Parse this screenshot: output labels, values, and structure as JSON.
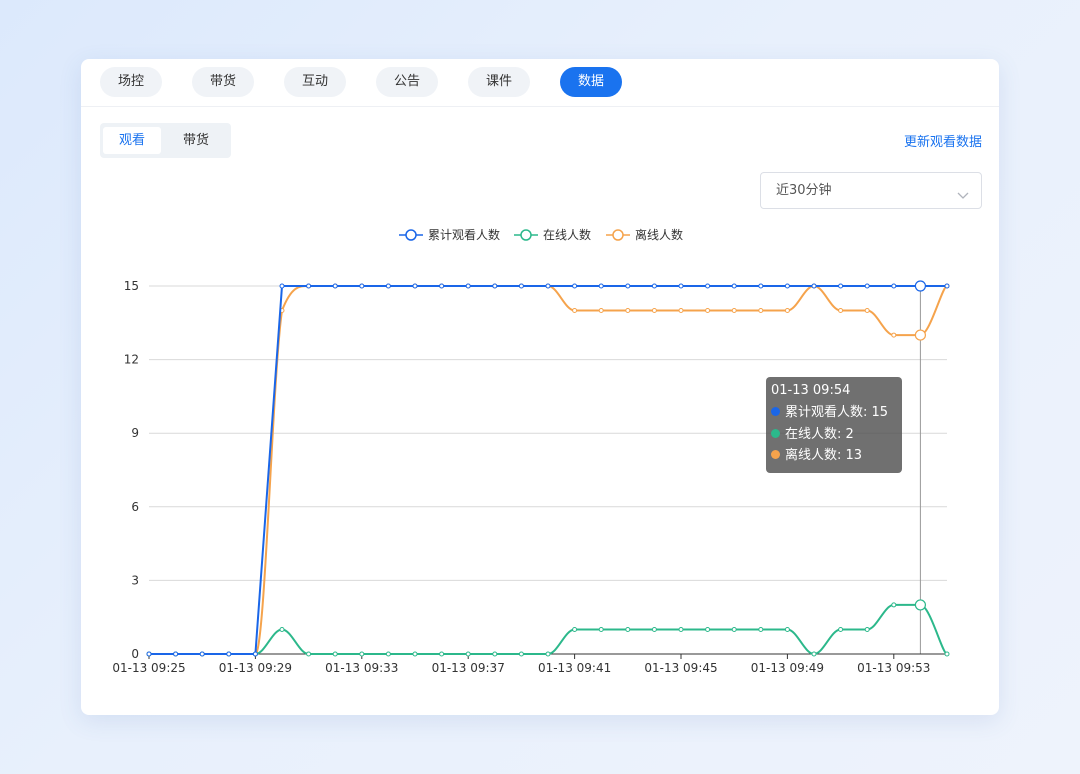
{
  "tabs": [
    {
      "label": "场控",
      "active": false
    },
    {
      "label": "带货",
      "active": false
    },
    {
      "label": "互动",
      "active": false
    },
    {
      "label": "公告",
      "active": false
    },
    {
      "label": "课件",
      "active": false
    },
    {
      "label": "数据",
      "active": true
    }
  ],
  "subtabs": [
    {
      "label": "观看",
      "active": true
    },
    {
      "label": "带货",
      "active": false
    }
  ],
  "refresh_label": "更新观看数据",
  "range_select": {
    "value": "近30分钟",
    "icon": "chevron-down-icon"
  },
  "tooltip": {
    "time": "01-13 09:54",
    "rows": [
      {
        "text": "累计观看人数: 15",
        "color": "#1a66e8"
      },
      {
        "text": "在线人数: 2",
        "color": "#2cb88b"
      },
      {
        "text": "离线人数: 13",
        "color": "#f5a34c"
      }
    ]
  },
  "colors": {
    "accent": "#1a73ef"
  },
  "chart_data": {
    "type": "line",
    "x": [
      "01-13 09:25",
      "01-13 09:26",
      "01-13 09:27",
      "01-13 09:28",
      "01-13 09:29",
      "01-13 09:30",
      "01-13 09:31",
      "01-13 09:32",
      "01-13 09:33",
      "01-13 09:34",
      "01-13 09:35",
      "01-13 09:36",
      "01-13 09:37",
      "01-13 09:38",
      "01-13 09:39",
      "01-13 09:40",
      "01-13 09:41",
      "01-13 09:42",
      "01-13 09:43",
      "01-13 09:44",
      "01-13 09:45",
      "01-13 09:46",
      "01-13 09:47",
      "01-13 09:48",
      "01-13 09:49",
      "01-13 09:50",
      "01-13 09:51",
      "01-13 09:52",
      "01-13 09:53",
      "01-13 09:54",
      "01-13 09:55"
    ],
    "x_tick_labels": [
      "01-13 09:25",
      "01-13 09:29",
      "01-13 09:33",
      "01-13 09:37",
      "01-13 09:41",
      "01-13 09:45",
      "01-13 09:49",
      "01-13 09:53"
    ],
    "y_ticks": [
      "0",
      "3",
      "6",
      "9",
      "12",
      "15"
    ],
    "ylim": [
      0,
      15
    ],
    "grid": true,
    "legend_position": "top-center",
    "highlight_index": 29,
    "series": [
      {
        "name": "累计观看人数",
        "color": "#1a66e8",
        "values": [
          0,
          0,
          0,
          0,
          0,
          15,
          15,
          15,
          15,
          15,
          15,
          15,
          15,
          15,
          15,
          15,
          15,
          15,
          15,
          15,
          15,
          15,
          15,
          15,
          15,
          15,
          15,
          15,
          15,
          15,
          15
        ]
      },
      {
        "name": "在线人数",
        "color": "#2cb88b",
        "values": [
          0,
          0,
          0,
          0,
          0,
          1,
          0,
          0,
          0,
          0,
          0,
          0,
          0,
          0,
          0,
          0,
          1,
          1,
          1,
          1,
          1,
          1,
          1,
          1,
          1,
          0,
          1,
          1,
          2,
          2,
          0
        ]
      },
      {
        "name": "离线人数",
        "color": "#f5a34c",
        "values": [
          0,
          0,
          0,
          0,
          0,
          14,
          15,
          15,
          15,
          15,
          15,
          15,
          15,
          15,
          15,
          15,
          14,
          14,
          14,
          14,
          14,
          14,
          14,
          14,
          14,
          15,
          14,
          14,
          13,
          13,
          15
        ]
      }
    ]
  }
}
